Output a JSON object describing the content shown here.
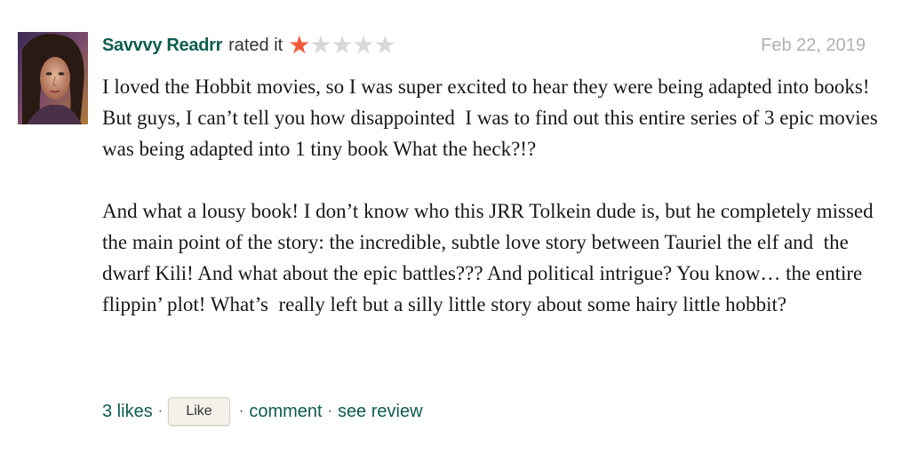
{
  "review": {
    "user_name": "Savvvy Readrr",
    "rated_text": "rated it",
    "rating": 1,
    "max_rating": 5,
    "date": "Feb 22, 2019",
    "paragraphs": [
      "I loved the Hobbit movies, so I was super excited to hear they were being adapted into books! But guys, I can’t tell you how disappointed  I was to find out this entire series of 3 epic movies was being adapted into 1 tiny book What the heck?!?",
      "And what a lousy book! I don’t know who this JRR Tolkein dude is, but he completely missed the main point of the story: the incredible, subtle love story between Tauriel the elf and  the dwarf Kili! And what about the epic battles??? And political intrigue? You know… the entire flippin’ plot! What’s  really left but a silly little story about some hairy little hobbit?"
    ]
  },
  "footer": {
    "likes_label": "3 likes",
    "like_button": "Like",
    "comment_label": "comment",
    "see_review_label": "see review",
    "separator": "·"
  },
  "colors": {
    "link": "#0d5c4f",
    "star_on": "#f25a3c",
    "star_off": "#d8d8d8",
    "date": "#b0b0b0"
  },
  "icons": {
    "star": "star-icon"
  }
}
